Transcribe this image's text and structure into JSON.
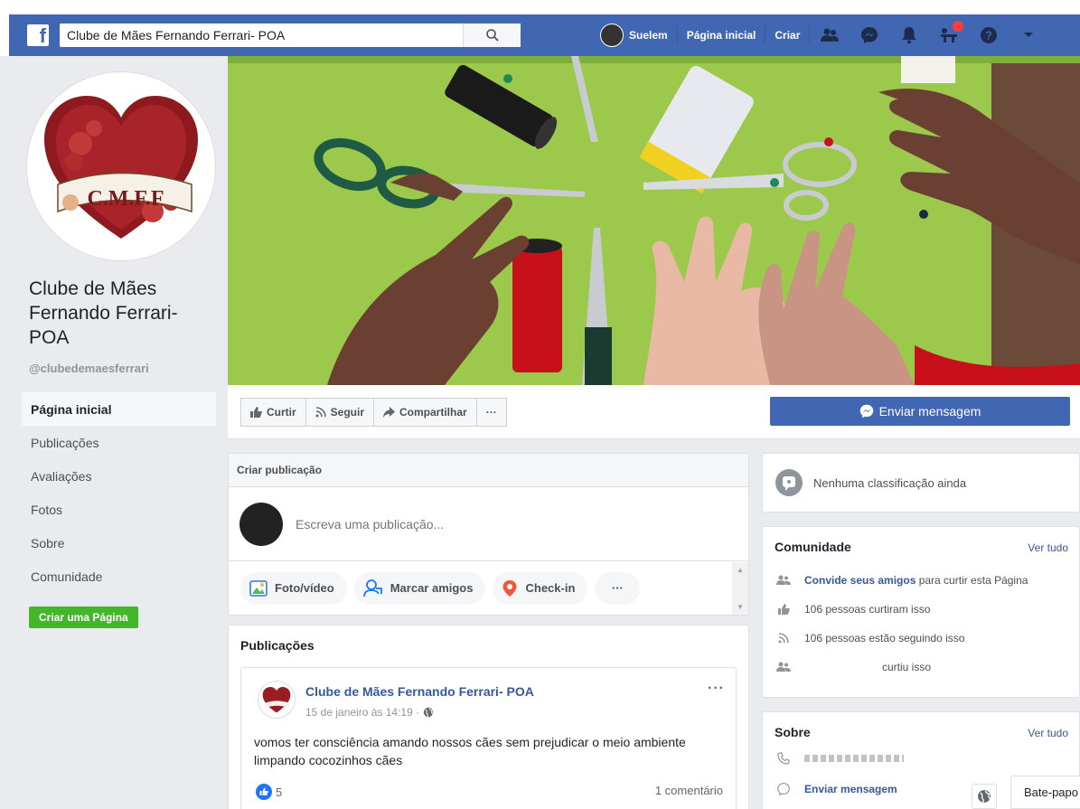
{
  "topbar": {
    "search_value": "Clube de Mães Fernando Ferrari- POA",
    "user_name": "Suelem",
    "home_label": "Página inicial",
    "create_label": "Criar"
  },
  "sidebar": {
    "page_name": "Clube de Mães Fernando Ferrari- POA",
    "handle": "@clubedemaesferrari",
    "logo_text": "C.M.F.F",
    "items": [
      {
        "label": "Página inicial"
      },
      {
        "label": "Publicações"
      },
      {
        "label": "Avaliações"
      },
      {
        "label": "Fotos"
      },
      {
        "label": "Sobre"
      },
      {
        "label": "Comunidade"
      }
    ],
    "create_page": "Criar uma Página"
  },
  "actions": {
    "like": "Curtir",
    "follow": "Seguir",
    "share": "Compartilhar",
    "more": "···",
    "send_message": "Enviar mensagem"
  },
  "create_post": {
    "header": "Criar publicação",
    "placeholder": "Escreva uma publicação...",
    "photo_video": "Foto/vídeo",
    "tag_friends": "Marcar amigos",
    "checkin": "Check-in",
    "more": "···"
  },
  "posts": {
    "title": "Publicações",
    "items": [
      {
        "author": "Clube de Mães Fernando Ferrari- POA",
        "time": "15 de janeiro às 14:19 ·",
        "text": "vomos ter consciência amando nossos cães sem prejudicar o meio ambiente limpando cocozinhos cães",
        "likes": "5",
        "comments": "1 comentário",
        "more": "···"
      }
    ]
  },
  "rating": {
    "text": "Nenhuma classificação ainda"
  },
  "community": {
    "title": "Comunidade",
    "see_all": "Ver tudo",
    "invite_link": "Convide seus amigos",
    "invite_rest": " para curtir esta Página",
    "likes": "106 pessoas curtiram isso",
    "follows": "106 pessoas estão seguindo isso",
    "liked_by": "curtiu isso"
  },
  "about": {
    "title": "Sobre",
    "see_all": "Ver tudo",
    "send_message": "Enviar mensagem"
  },
  "chat": {
    "label": "Bate-papo"
  },
  "colors": {
    "facebook_blue": "#4267b2",
    "link_blue": "#365899",
    "green": "#42b72a",
    "cover_green": "#9bc84a"
  }
}
